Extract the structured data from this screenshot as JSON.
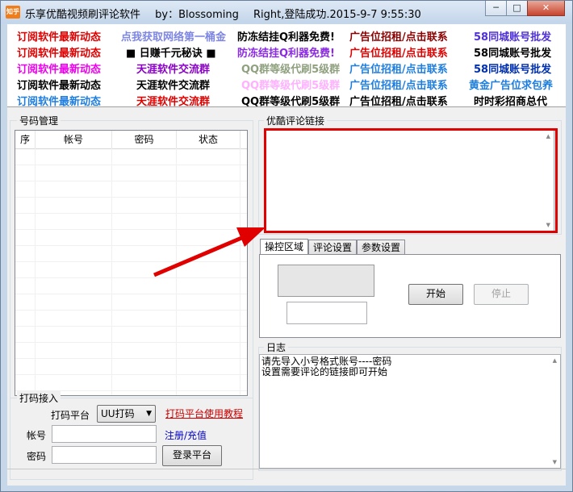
{
  "window": {
    "icon_text": "知乎",
    "title": "乐享优酷视频刷评论软件",
    "author": "by：Blossoming",
    "status": "Right,登陆成功.2015-9-7 9:55:30",
    "min_glyph": "─",
    "max_glyph": "□",
    "close_glyph": "✕"
  },
  "ads": [
    [
      {
        "text": "订阅软件最新动态",
        "color": "#e00000"
      },
      {
        "text": "点我获取网络第一桶金",
        "color": "#7e86e3"
      },
      {
        "text": "防冻结挂Q利器免费!",
        "color": "#000000"
      },
      {
        "text": "广告位招租/点击联系",
        "color": "#8b0000"
      },
      {
        "text": "58同城账号批发",
        "color": "#5030d8"
      }
    ],
    [
      {
        "text": "订阅软件最新动态",
        "color": "#e00000"
      },
      {
        "text": "■ 日赚千元秘诀 ■",
        "color": "#000000"
      },
      {
        "text": "防冻结挂Q利器免费!",
        "color": "#8a2be2"
      },
      {
        "text": "广告位招租/点击联系",
        "color": "#e00000"
      },
      {
        "text": "58同城账号批发",
        "color": "#000000"
      }
    ],
    [
      {
        "text": "订阅软件最新动态",
        "color": "#ee00ee"
      },
      {
        "text": "天涯软件交流群",
        "color": "#8a00c8"
      },
      {
        "text": "QQ群等级代刷5级群",
        "color": "#8fa07f"
      },
      {
        "text": "广告位招租/点击联系",
        "color": "#1e7ee0"
      },
      {
        "text": "58同城账号批发",
        "color": "#0030b0"
      }
    ],
    [
      {
        "text": "订阅软件最新动态",
        "color": "#000000"
      },
      {
        "text": "天涯软件交流群",
        "color": "#000000"
      },
      {
        "text": "QQ群等级代刷5级群",
        "color": "#ffb0ff"
      },
      {
        "text": "广告位招租/点击联系",
        "color": "#1e7ee0"
      },
      {
        "text": "黄金广告位求包养",
        "color": "#1e7ee0"
      }
    ],
    [
      {
        "text": "订阅软件最新动态",
        "color": "#1e7ee0"
      },
      {
        "text": "天涯软件交流群",
        "color": "#e00000"
      },
      {
        "text": "QQ群等级代刷5级群",
        "color": "#000000"
      },
      {
        "text": "广告位招租/点击联系",
        "color": "#000000"
      },
      {
        "text": "时时彩招商总代",
        "color": "#000000"
      }
    ]
  ],
  "accounts": {
    "group_label": "号码管理",
    "columns": [
      "序",
      "帐号",
      "密码",
      "状态"
    ]
  },
  "link_group": {
    "label": "优酷评论链接",
    "value": ""
  },
  "tabs": [
    "操控区域",
    "评论设置",
    "参数设置"
  ],
  "control": {
    "start_label": "开始",
    "stop_label": "停止"
  },
  "log": {
    "label": "日志",
    "text": "请先导入小号格式账号----密码\n设置需要评论的链接即可开始"
  },
  "captcha": {
    "group_label": "打码接入",
    "platform_label": "打码平台",
    "platform_value": "UU打码",
    "tutorial_link": "打码平台使用教程",
    "account_label": "帐号",
    "password_label": "密码",
    "register_link": "注册/充值",
    "login_label": "登录平台"
  },
  "colors": {
    "highlight": "#e00000",
    "link": "#0000cc",
    "tutorial": "#cc0000"
  }
}
